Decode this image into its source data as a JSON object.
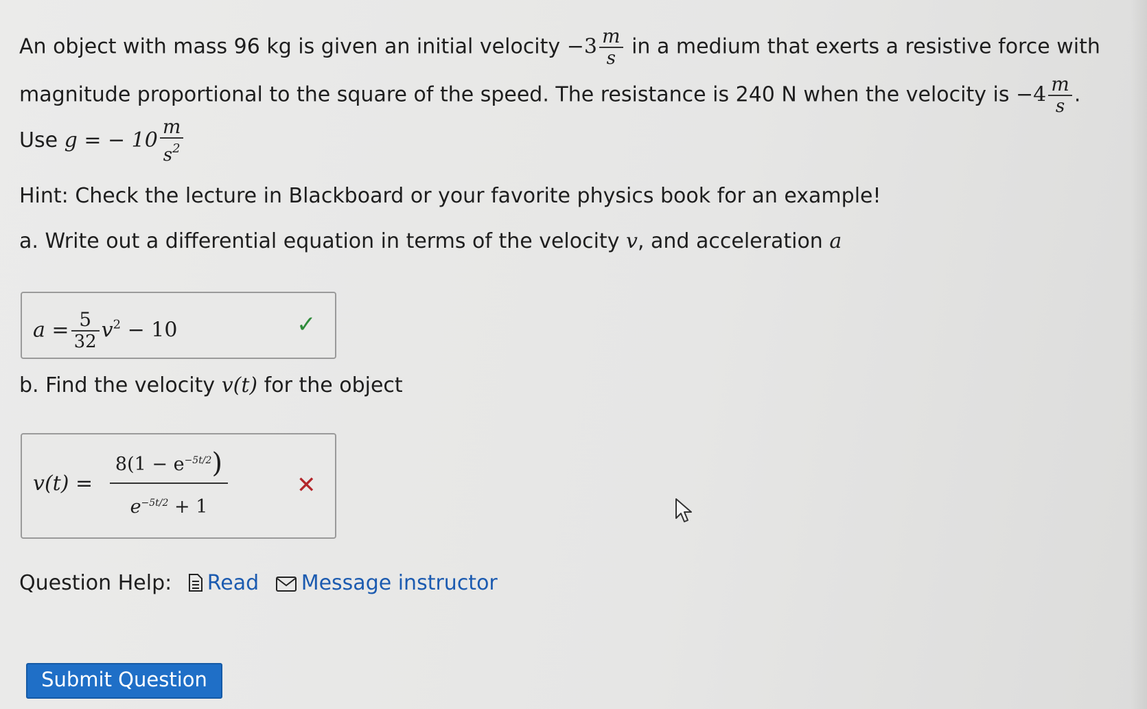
{
  "problem": {
    "line1_a": "An object with mass 96 kg is given an initial velocity",
    "line1_v0": "−3",
    "line1_b": "in a medium that exerts a resistive force with",
    "line2_a": "magnitude proportional to the square of the speed. The resistance is 240 N when the velocity is",
    "line2_v": "−4",
    "line3_a": "Use",
    "line3_g": "g = − 10",
    "unit_m": "m",
    "unit_s": "s",
    "unit_s2": "s",
    "unit_exp": "2",
    "hint": "Hint: Check the lecture in Blackboard or your favorite physics book for an example!"
  },
  "part_a": {
    "prompt_a": "a. Write out a differential equation in terms of the velocity",
    "var_v": "v",
    "prompt_b": ", and acceleration",
    "var_a": "a",
    "answer_lhs": "a =",
    "frac_num": "5",
    "frac_den": "32",
    "answer_v": "v",
    "answer_exp": "2",
    "answer_tail": "− 10",
    "status": "correct"
  },
  "part_b": {
    "prompt_a": "b. Find the velocity",
    "var_vt": "v(t)",
    "prompt_b": "for the object",
    "answer_lhs": "v(t) =",
    "num_text": "8(1 − e",
    "num_exp": "−5t/2",
    "num_close": ")",
    "den_text": "e",
    "den_exp": "−5t/2",
    "den_tail": "+ 1",
    "status": "incorrect"
  },
  "help": {
    "label": "Question Help:",
    "read": "Read",
    "message": "Message instructor"
  },
  "submit_label": "Submit Question",
  "colors": {
    "accent": "#1f6fc7",
    "correct": "#2e8b3a",
    "incorrect": "#b3262a",
    "link": "#1c5bb0"
  }
}
